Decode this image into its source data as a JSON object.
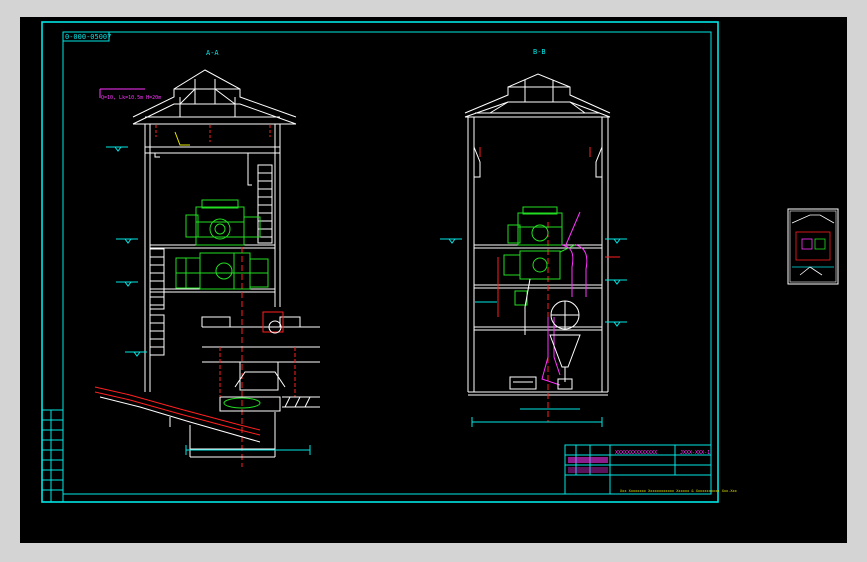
{
  "drawing": {
    "stamp": "0-000-05007",
    "section_a_label": "A-A",
    "section_b_label": "B-B",
    "crane_label": "Q=10, Lk=10.5m  H=20m",
    "title_block": {
      "drawing_number": "JXXX-XXX-1",
      "title_cn": "XXXXXXXXXXXXXX",
      "company": "Xxx Xxxxxxxx Xxxxxxxxxxxx Xxxxxx & Xxxxxxxxxxx Xxx.Xxx"
    }
  },
  "colors": {
    "background": "#000000",
    "frame": "#00e6e6",
    "equipment": "#22dd22",
    "dimension": "#ff2020",
    "pipe": "#ff33ff"
  }
}
